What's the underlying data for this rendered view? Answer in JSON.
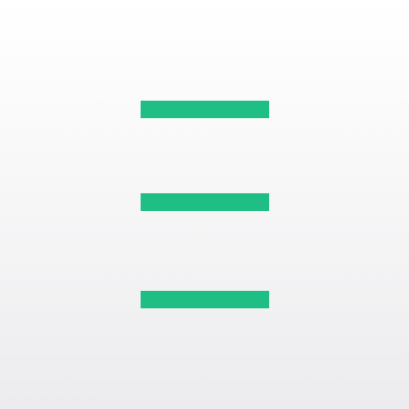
{
  "menu": {
    "icon": "hamburger-menu-icon",
    "line_color": "#1ebe84",
    "line_count": 3
  },
  "background": {
    "top_color": "#ffffff",
    "bottom_color": "#ececee"
  }
}
